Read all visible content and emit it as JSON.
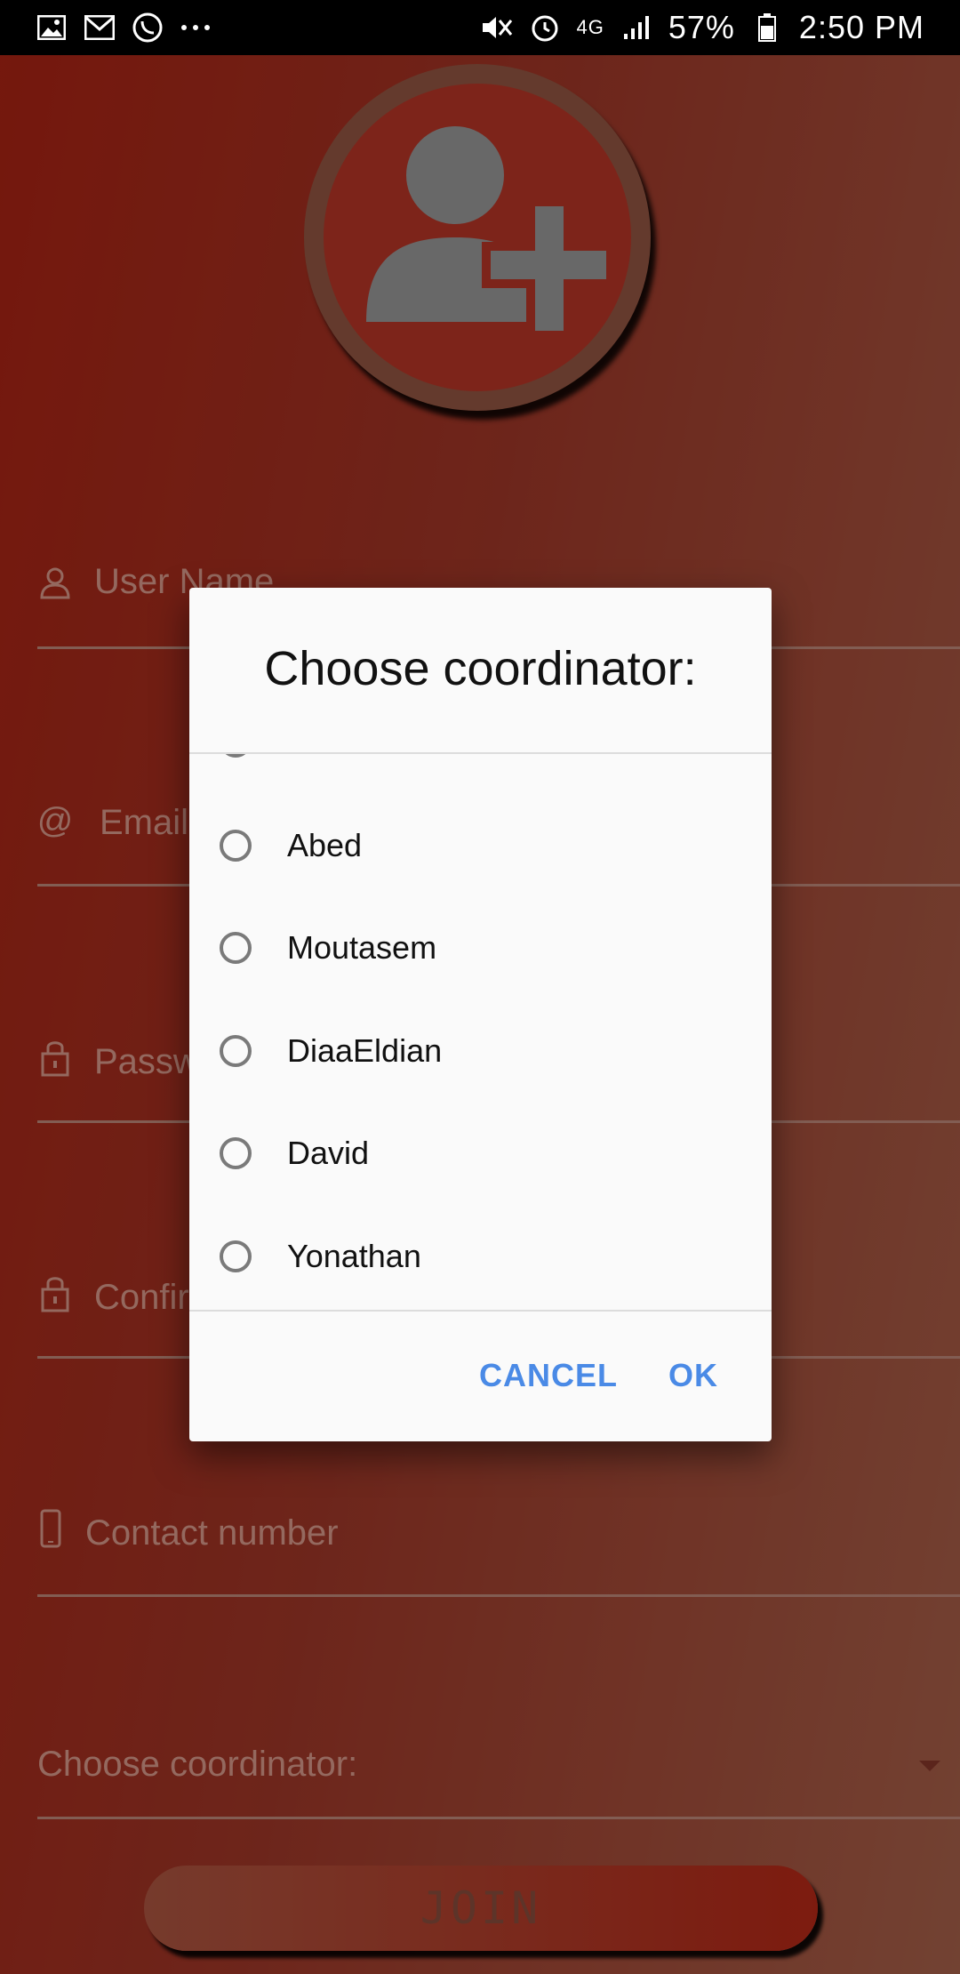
{
  "status_bar": {
    "time": "2:50 PM",
    "battery": "57%",
    "network": "4G"
  },
  "form": {
    "user_name_placeholder": "User Name",
    "email_placeholder": "Email",
    "password_placeholder": "Passw",
    "confirm_placeholder": "Confir",
    "contact_placeholder": "Contact number",
    "coordinator_label": "Choose coordinator:",
    "join_label": "JOIN"
  },
  "dialog": {
    "title": "Choose coordinator:",
    "options": [
      "Abed",
      "Moutasem",
      "DiaaEldian",
      "David",
      "Yonathan"
    ],
    "cancel_label": "CANCEL",
    "ok_label": "OK"
  },
  "colors": {
    "accent": "#4a8ae6",
    "background_red": "#b42414"
  }
}
